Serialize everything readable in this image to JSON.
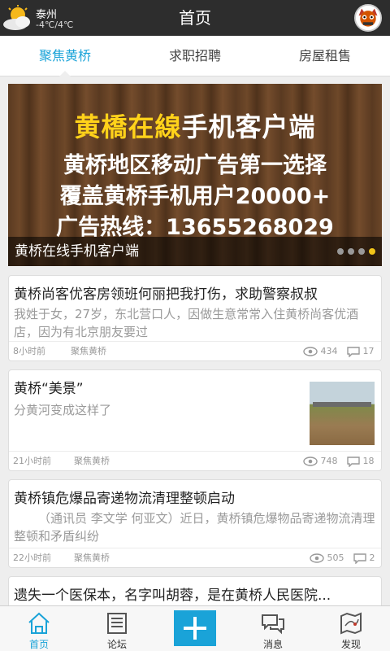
{
  "header": {
    "title": "首页",
    "weather": {
      "city": "泰州",
      "temp": "-4℃/4℃",
      "icon": "sun-cloud-icon"
    }
  },
  "tabs": [
    {
      "label": "聚焦黄桥",
      "active": true
    },
    {
      "label": "求职招聘",
      "active": false
    },
    {
      "label": "房屋租售",
      "active": false
    }
  ],
  "banner": {
    "line1_a": "黄橋在線",
    "line1_b": "手机客户端",
    "line2": "黄桥地区移动广告第一选择",
    "line3": "覆盖黄桥手机用户20000+",
    "line4": "广告热线：13655268029",
    "caption": "黄桥在线手机客户端",
    "slides_total": 4,
    "slide_active": 4
  },
  "articles": [
    {
      "title": "黄桥尚客优客房领班何丽把我打伤，求助警察叔叔",
      "desc": "我姓于女，27岁，东北营口人，因做生意常常入住黄桥尚客优酒店，因为有北京朋友要过",
      "time": "8小时前",
      "source": "聚焦黄桥",
      "views": "434",
      "comments": "17"
    },
    {
      "title": "黄桥“美景”",
      "desc": "分黄河变成这样了",
      "time": "21小时前",
      "source": "聚焦黄桥",
      "views": "748",
      "comments": "18"
    },
    {
      "title": "黄桥镇危爆品寄递物流清理整顿启动",
      "desc": "（通讯员 李文学 何亚文）近日，黄桥镇危爆物品寄递物流清理整顿和矛盾纠纷",
      "time": "22小时前",
      "source": "聚焦黄桥",
      "views": "505",
      "comments": "2"
    },
    {
      "title": "遗失一个医保本，名字叫胡蓉，是在黄桥人民医院..."
    }
  ],
  "nav": [
    {
      "label": "首页",
      "icon": "home-icon",
      "active": true
    },
    {
      "label": "论坛",
      "icon": "forum-icon",
      "active": false
    },
    {
      "label": "",
      "icon": "plus-icon",
      "active": false
    },
    {
      "label": "消息",
      "icon": "message-icon",
      "active": false
    },
    {
      "label": "发现",
      "icon": "discover-map-icon",
      "active": false
    }
  ],
  "colors": {
    "accent": "#1aa3d8",
    "topbar": "#2d2d2d",
    "banner_yellow": "#ffd21a"
  }
}
